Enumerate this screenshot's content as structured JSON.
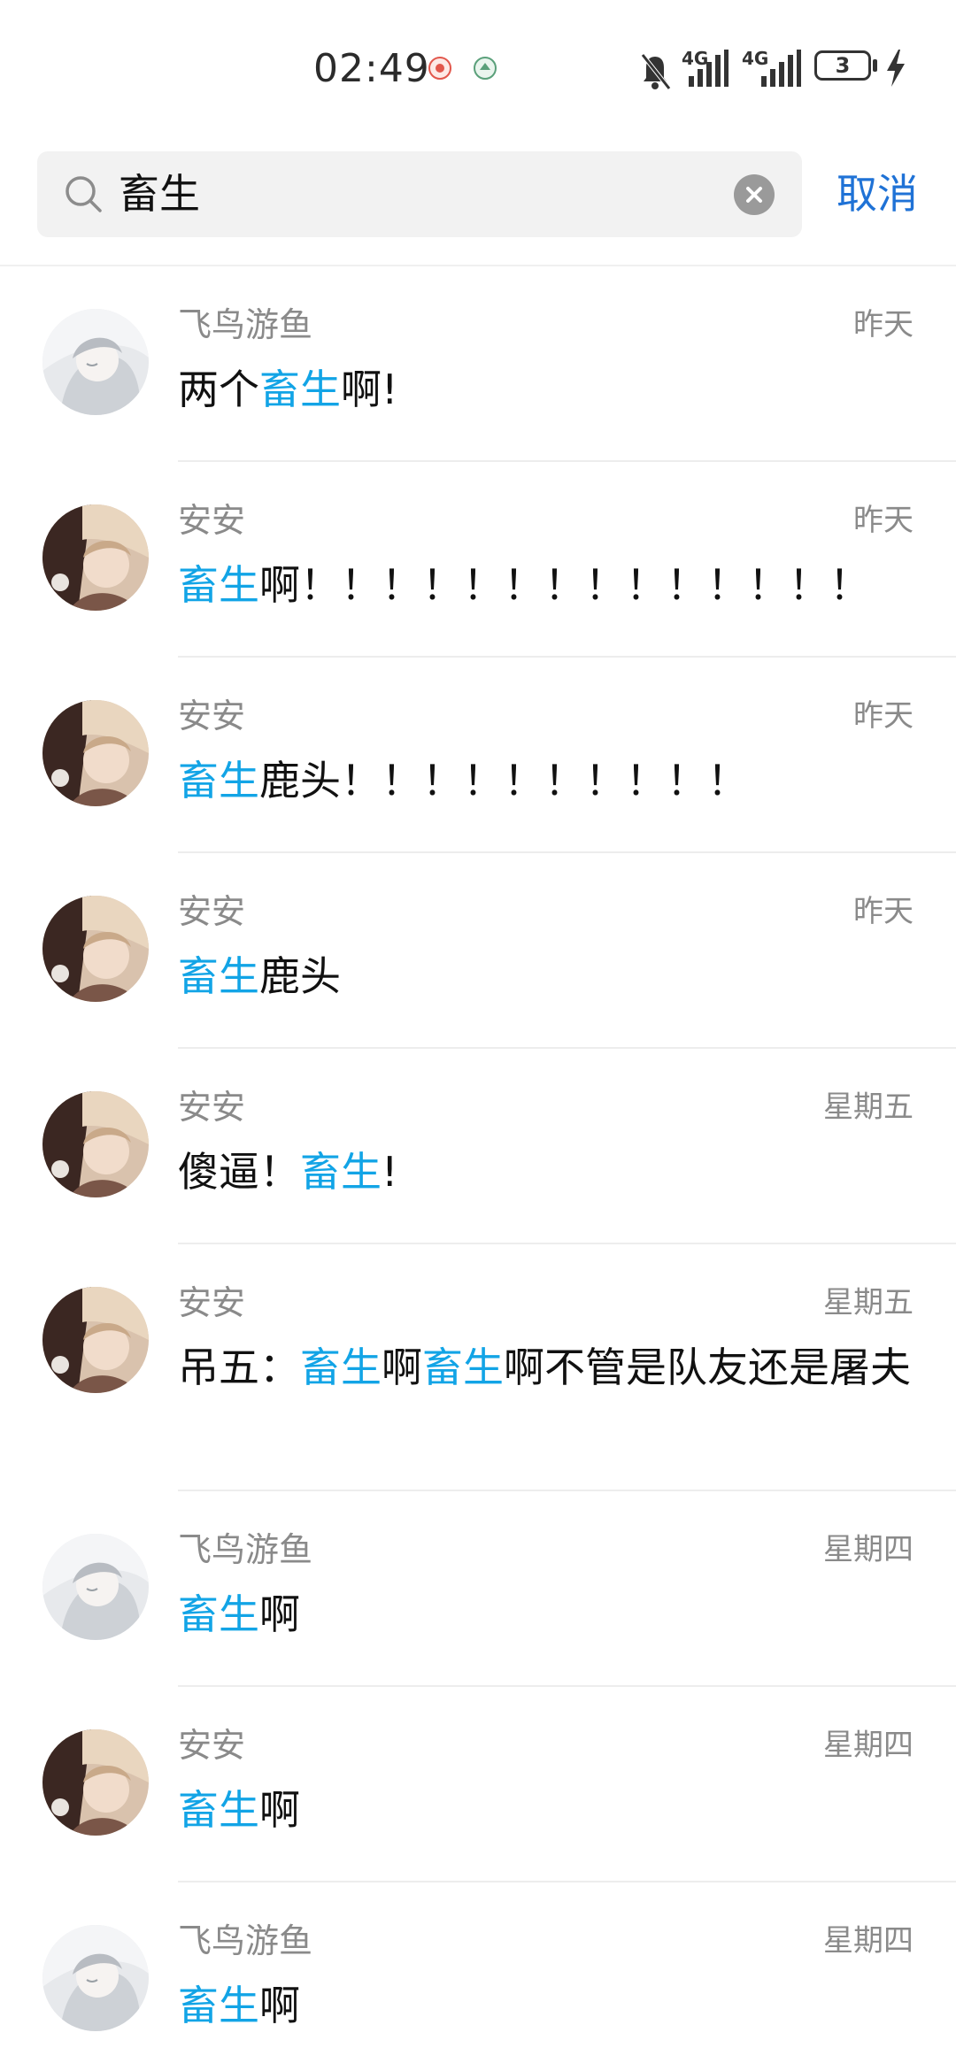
{
  "status_bar": {
    "time": "02:49",
    "network_1": "4G",
    "network_2": "4G",
    "battery_level": "3",
    "icons": [
      "notification-app-icon",
      "notification-app-icon",
      "mute-bell-icon",
      "signal-icon",
      "signal-icon",
      "battery-icon",
      "charging-bolt-icon"
    ]
  },
  "search": {
    "query": "畜生",
    "cancel_label": "取消"
  },
  "colors": {
    "highlight": "#12a4e6",
    "cancel": "#1f72d6",
    "secondary_text": "#8a8a8a",
    "search_bg": "#f2f2f2"
  },
  "results": [
    {
      "sender": "飞鸟游鱼",
      "time": "昨天",
      "avatar": "avatar-white-hair",
      "message": [
        {
          "t": "两个"
        },
        {
          "t": "畜生",
          "hl": true
        },
        {
          "t": "啊!"
        }
      ]
    },
    {
      "sender": "安安",
      "time": "昨天",
      "avatar": "avatar-beige-hair",
      "message": [
        {
          "t": "畜生",
          "hl": true
        },
        {
          "t": "啊！！！！！！！！！！！！！！"
        }
      ]
    },
    {
      "sender": "安安",
      "time": "昨天",
      "avatar": "avatar-beige-hair",
      "message": [
        {
          "t": "畜生",
          "hl": true
        },
        {
          "t": "鹿头！！！！！！！！！！"
        }
      ]
    },
    {
      "sender": "安安",
      "time": "昨天",
      "avatar": "avatar-beige-hair",
      "message": [
        {
          "t": "畜生",
          "hl": true
        },
        {
          "t": "鹿头"
        }
      ]
    },
    {
      "sender": "安安",
      "time": "星期五",
      "avatar": "avatar-beige-hair",
      "message": [
        {
          "t": "傻逼！"
        },
        {
          "t": "畜生",
          "hl": true
        },
        {
          "t": "!"
        }
      ]
    },
    {
      "sender": "安安",
      "time": "星期五",
      "avatar": "avatar-beige-hair",
      "message": [
        {
          "t": "吊五："
        },
        {
          "t": "畜生",
          "hl": true
        },
        {
          "t": "啊"
        },
        {
          "t": "畜生",
          "hl": true
        },
        {
          "t": "啊不管是队友还是屠夫"
        }
      ]
    },
    {
      "sender": "飞鸟游鱼",
      "time": "星期四",
      "avatar": "avatar-white-hair",
      "message": [
        {
          "t": "畜生",
          "hl": true
        },
        {
          "t": "啊"
        }
      ]
    },
    {
      "sender": "安安",
      "time": "星期四",
      "avatar": "avatar-beige-hair",
      "message": [
        {
          "t": "畜生",
          "hl": true
        },
        {
          "t": "啊"
        }
      ]
    },
    {
      "sender": "飞鸟游鱼",
      "time": "星期四",
      "avatar": "avatar-white-hair",
      "message": [
        {
          "t": "畜生",
          "hl": true
        },
        {
          "t": "啊"
        }
      ]
    }
  ]
}
